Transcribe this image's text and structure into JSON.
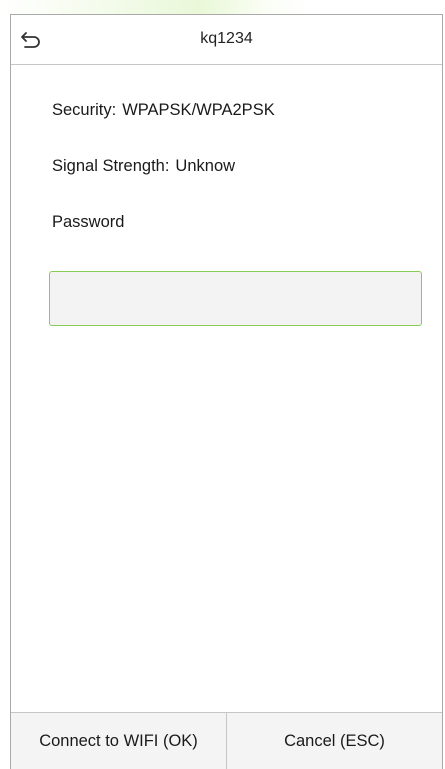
{
  "header": {
    "title": "kq1234",
    "back_icon": "back-arrow-icon"
  },
  "details": {
    "security_label": "Security:",
    "security_value": "WPAPSK/WPA2PSK",
    "signal_label": "Signal Strength:",
    "signal_value": "Unknow",
    "password_label": "Password"
  },
  "password_field": {
    "value": "",
    "placeholder": ""
  },
  "footer": {
    "connect_label": "Connect to WIFI (OK)",
    "cancel_label": "Cancel (ESC)"
  },
  "colors": {
    "input_border": "#88cc55",
    "divider": "#c6c6c6"
  }
}
